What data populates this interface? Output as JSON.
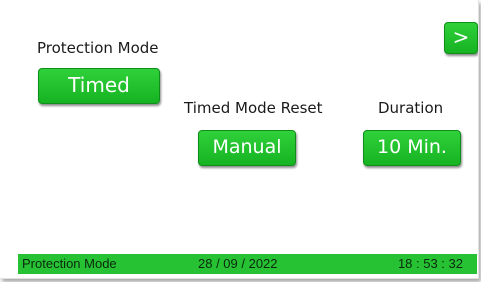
{
  "header": {
    "next_button_label": ">"
  },
  "protection_mode": {
    "label": "Protection Mode",
    "value": "Timed"
  },
  "timed_mode_reset": {
    "label": "Timed Mode Reset",
    "value": "Manual"
  },
  "duration": {
    "label": "Duration",
    "value": "10 Min."
  },
  "status_bar": {
    "mode": "Protection Mode",
    "date": "28 / 09 / 2022",
    "time": "18 : 53 : 32"
  },
  "colors": {
    "button_green": "#1fc22b",
    "status_green": "#27c234",
    "button_text": "#ffffff",
    "label_text": "#1a1a1a"
  }
}
